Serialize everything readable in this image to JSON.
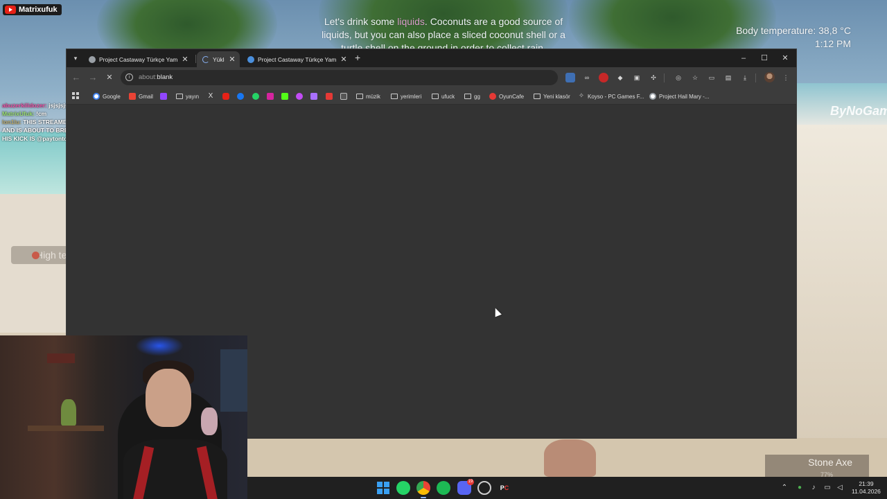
{
  "stream": {
    "channel": "Matrixufuk",
    "chat": [
      {
        "user": "abuzerkilidozer:",
        "text": " jsjsjsjsjs"
      },
      {
        "user": "MatrixUfuk:",
        "text": " !cm"
      },
      {
        "user": "lon1lu:",
        "text": " THIS STREAMER JUST SNIFFED LINES AND IS ABOUT TO BREAK HIS WINDOW LOLL .. HIS KICK IS @paytontoocheesy"
      }
    ]
  },
  "game": {
    "tip_start": "Let's drink some ",
    "tip_highlight": "liquids",
    "tip_rest": ". Coconuts are a good source of liquids, but you can also place a sliced coconut shell or a turtle shell on the ground in order to collect rain.",
    "body_temperature": "Body temperature: 38,8 °C",
    "time": "1:12 PM",
    "watermark": "ByNoGame",
    "status_warning": "High te",
    "equipped_item": "Stone Axe",
    "equipped_durability": "77%"
  },
  "browser": {
    "tabs": [
      {
        "label": "Project Castaway Türkçe Yama |",
        "active": false,
        "icon_color": "#9aa0a6"
      },
      {
        "label": "Yükler",
        "active": true,
        "icon_color": "#8ab4f8"
      },
      {
        "label": "Project Castaway Türkçe Yama -",
        "active": false,
        "icon_color": "#4a8fdc"
      }
    ],
    "omnibox": {
      "scheme": "about:",
      "path": "blank"
    },
    "bookmarks": [
      {
        "label": "Google",
        "icon": "google-icon",
        "color": "#4285f4"
      },
      {
        "label": "Gmail",
        "icon": "gmail-icon",
        "color": "#ea4335"
      },
      {
        "label": "",
        "icon": "twitch-icon",
        "color": "#9146ff"
      },
      {
        "label": "yayın",
        "icon": "folder-icon"
      },
      {
        "label": "",
        "icon": "x-icon",
        "color": "#e0e0e0"
      },
      {
        "label": "",
        "icon": "youtube-icon",
        "color": "#e62117"
      },
      {
        "label": "",
        "icon": "facebook-icon",
        "color": "#1877f2"
      },
      {
        "label": "",
        "icon": "whatsapp-icon",
        "color": "#25d366"
      },
      {
        "label": "",
        "icon": "instagram-icon",
        "color": "#d6249f"
      },
      {
        "label": "",
        "icon": "kick-icon",
        "color": "#53fc18"
      },
      {
        "label": "",
        "icon": "app-icon",
        "color": "#c24cf6"
      },
      {
        "label": "",
        "icon": "twitch-icon",
        "color": "#a970ff"
      },
      {
        "label": "",
        "icon": "app-icon",
        "color": "#e53935"
      },
      {
        "label": "",
        "icon": "app-icon",
        "color": "#bdbdbd"
      },
      {
        "label": "müzik",
        "icon": "folder-icon"
      },
      {
        "label": "yerimleri",
        "icon": "folder-icon"
      },
      {
        "label": "ufuck",
        "icon": "folder-icon"
      },
      {
        "label": "gg",
        "icon": "folder-icon"
      },
      {
        "label": "OyunCafe",
        "icon": "oyuncafe-icon",
        "color": "#e53935"
      },
      {
        "label": "Yeni klasör",
        "icon": "folder-icon"
      },
      {
        "label": "Koyso - PC Games F...",
        "icon": "koyso-icon",
        "color": "#bdbdbd"
      },
      {
        "label": "Project Hail Mary -...",
        "icon": "google-icon",
        "color": "#9aa0a6"
      }
    ]
  },
  "taskbar": {
    "apps": [
      "windows-start-icon",
      "whatsapp-icon",
      "chrome-icon",
      "spotify-icon",
      "discord-icon",
      "steam-icon",
      "pc-app-icon"
    ],
    "discord_badge": "19",
    "time": "21:39",
    "date": "11.04.2026"
  },
  "colors": {
    "browser_bg": "#333333",
    "tabstrip": "#1f1f1f",
    "toolbar": "#3c3c3c",
    "taskbar": "#202020"
  }
}
